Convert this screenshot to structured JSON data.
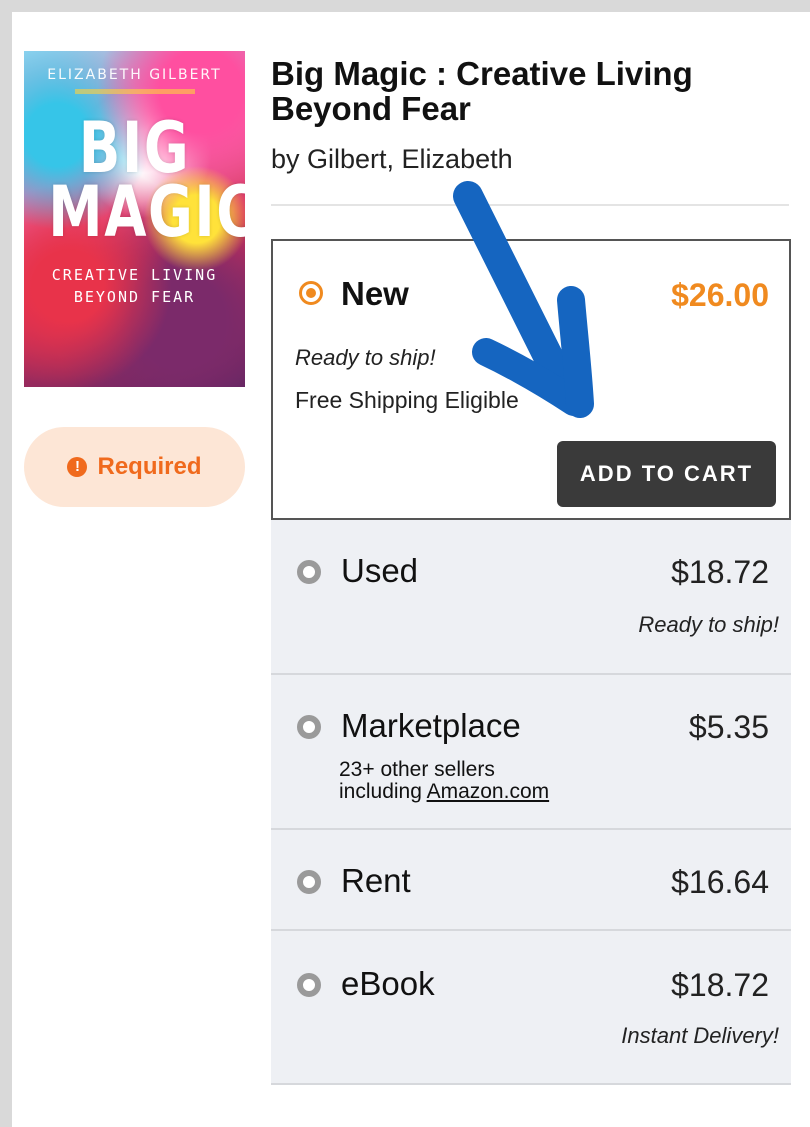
{
  "product": {
    "title": "Big Magic : Creative Living Beyond Fear",
    "byline": "by Gilbert, Elizabeth"
  },
  "cover": {
    "author": "ELIZABETH GILBERT",
    "title_line1": "BIG",
    "title_line2": "MAGIC",
    "tagline_line1": "CREATIVE LIVING",
    "tagline_line2": "BEYOND FEAR"
  },
  "required_badge": {
    "label": "Required",
    "icon": "exclamation-circle-icon"
  },
  "options": {
    "new": {
      "label": "New",
      "price": "$26.00",
      "note1": "Ready to ship!",
      "note2": "Free Shipping Eligible",
      "button": "ADD TO CART",
      "selected": true
    },
    "used": {
      "label": "Used",
      "price": "$18.72",
      "note": "Ready to ship!"
    },
    "marketplace": {
      "label": "Marketplace",
      "price": "$5.35",
      "sellers_line1": "23+ other sellers",
      "sellers_prefix": "including ",
      "sellers_link": "Amazon.com"
    },
    "rent": {
      "label": "Rent",
      "price": "$16.64"
    },
    "ebook": {
      "label": "eBook",
      "price": "$18.72",
      "note": "Instant Delivery!"
    }
  },
  "colors": {
    "accent_orange": "#f08a1f",
    "arrow_blue": "#1565c0",
    "button_dark": "#3a3a3a",
    "required_bg": "#fde6d6"
  }
}
